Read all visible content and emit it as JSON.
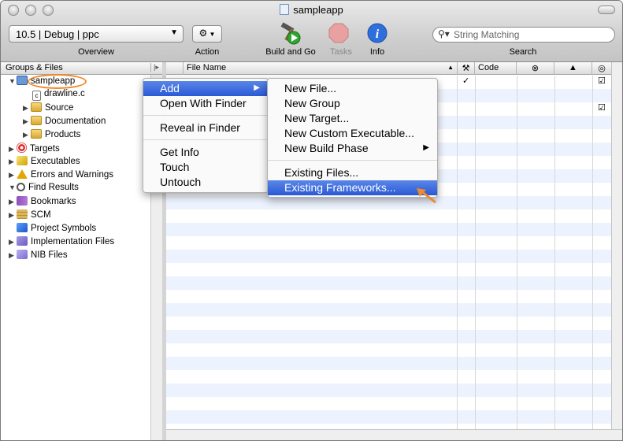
{
  "window": {
    "title": "sampleapp"
  },
  "toolbar": {
    "config_popup": "10.5 | Debug | ppc",
    "overview_label": "Overview",
    "action_label": "Action",
    "build_go_label": "Build and Go",
    "tasks_label": "Tasks",
    "info_label": "Info",
    "search_label": "Search",
    "search_placeholder": "String Matching"
  },
  "sidebar": {
    "header": "Groups & Files",
    "items": [
      {
        "label": "sampleapp",
        "expanded": true,
        "icon": "project-icon"
      },
      {
        "label": "drawline.c",
        "icon": "c-file-icon"
      },
      {
        "label": "Source",
        "icon": "folder-icon"
      },
      {
        "label": "Documentation",
        "icon": "folder-icon"
      },
      {
        "label": "Products",
        "icon": "folder-icon"
      },
      {
        "label": "Targets",
        "icon": "target-icon"
      },
      {
        "label": "Executables",
        "icon": "executable-icon"
      },
      {
        "label": "Errors and Warnings",
        "icon": "warning-icon"
      },
      {
        "label": "Find Results",
        "icon": "magnifier-icon"
      },
      {
        "label": "Bookmarks",
        "icon": "bookmark-icon"
      },
      {
        "label": "SCM",
        "icon": "scm-icon"
      },
      {
        "label": "Project Symbols",
        "icon": "cube-icon"
      },
      {
        "label": "Implementation Files",
        "icon": "smart-group-icon"
      },
      {
        "label": "NIB Files",
        "icon": "smart-group-icon"
      }
    ]
  },
  "file_list": {
    "columns": [
      "File Name",
      "Code"
    ],
    "check_mark": "✓"
  },
  "context_menu": {
    "items": [
      "Add",
      "Open With Finder",
      "Reveal in Finder",
      "Get Info",
      "Touch",
      "Untouch"
    ],
    "highlighted": "Add"
  },
  "submenu": {
    "items": [
      "New File...",
      "New Group",
      "New Target...",
      "New Custom Executable...",
      "New Build Phase",
      "Existing Files...",
      "Existing Frameworks..."
    ],
    "highlighted": "Existing Frameworks..."
  },
  "colors": {
    "highlight": "#2a59d6",
    "annotation_orange": "#f08a2c",
    "stripe": "#edf3fe"
  }
}
